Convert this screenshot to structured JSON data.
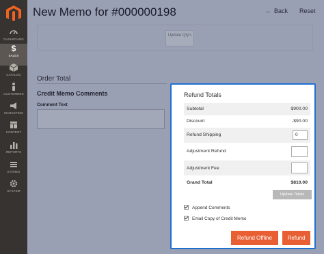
{
  "header": {
    "title": "New Memo for #000000198",
    "back_label": "Back",
    "reset_label": "Reset"
  },
  "sidebar": {
    "items": [
      {
        "label": "DASHBOARD",
        "icon": "dashboard-icon",
        "active": false
      },
      {
        "label": "SALES",
        "icon": "dollar-icon",
        "active": true
      },
      {
        "label": "CATALOG",
        "icon": "cube-icon",
        "active": false
      },
      {
        "label": "CUSTOMERS",
        "icon": "person-icon",
        "active": false
      },
      {
        "label": "MARKETING",
        "icon": "megaphone-icon",
        "active": false
      },
      {
        "label": "CONTENT",
        "icon": "layout-icon",
        "active": false
      },
      {
        "label": "REPORTS",
        "icon": "bar-chart-icon",
        "active": false
      },
      {
        "label": "STORES",
        "icon": "store-icon",
        "active": false
      },
      {
        "label": "SYSTEM",
        "icon": "gear-icon",
        "active": false
      }
    ]
  },
  "items_section": {
    "update_qty_label": "Update Qty's"
  },
  "order_total": {
    "title": "Order Total",
    "comments_title": "Credit Memo Comments",
    "comment_label": "Comment Text",
    "comment_value": ""
  },
  "refund_totals": {
    "title": "Refund Totals",
    "subtotal_label": "Subtotal",
    "subtotal_value": "$900.00",
    "discount_label": "Discount",
    "discount_value": "-$90.00",
    "shipping_label": "Refund Shipping",
    "shipping_value": "0",
    "adj_refund_label": "Adjustment Refund",
    "adj_refund_value": "",
    "adj_fee_label": "Adjustment Fee",
    "adj_fee_value": "",
    "grand_total_label": "Grand Total",
    "grand_total_value": "$810.00",
    "update_totals_label": "Update Totals",
    "append_comments_label": "Append Comments",
    "email_copy_label": "Email Copy of Credit Memo",
    "refund_offline_label": "Refund Offline",
    "refund_label": "Refund"
  },
  "colors": {
    "accent": "#e85f34",
    "panel_border": "#1f6fd1",
    "sidebar": "#373330",
    "overlay": "#9aa0b3"
  }
}
